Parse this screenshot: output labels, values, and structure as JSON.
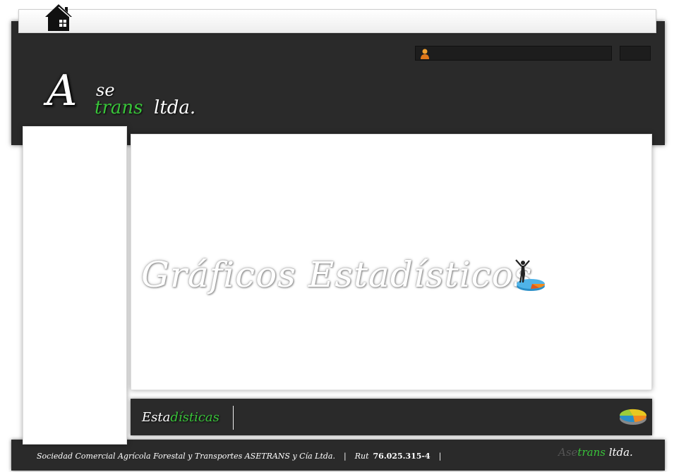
{
  "logo": {
    "a": "A",
    "se": "se",
    "trans": "trans",
    "ltda": "ltda."
  },
  "main": {
    "title": "Gráficos Estadísticos"
  },
  "section": {
    "title_a": "Esta",
    "title_b": "dísticas"
  },
  "footer": {
    "company": "Sociedad Comercial Agrícola Forestal y Transportes ASETRANS y Cía Ltda.",
    "sep": "|",
    "rut_label": "Rut",
    "rut_value": "76.025.315-4",
    "logo_a": "Ase",
    "logo_trans": "trans",
    "logo_ltda": " ltda."
  },
  "colors": {
    "accent": "#39c43a",
    "header_bg": "#2a2a2a"
  },
  "icons": {
    "home": "home-icon",
    "user": "user-icon",
    "chart": "chart-person-icon",
    "pie": "pie-chart-icon"
  }
}
